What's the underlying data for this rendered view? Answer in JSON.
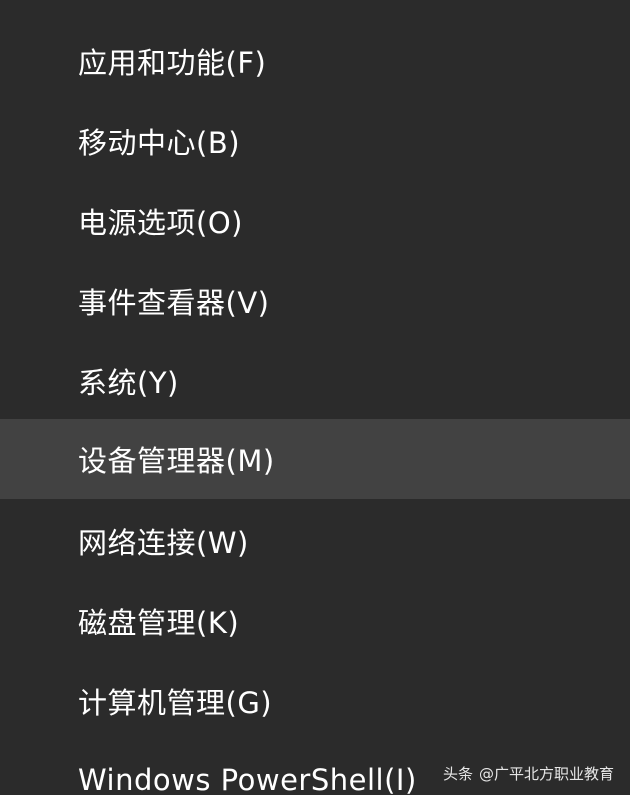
{
  "menu": {
    "items": [
      {
        "label": "应用和功能(F)"
      },
      {
        "label": "移动中心(B)"
      },
      {
        "label": "电源选项(O)"
      },
      {
        "label": "事件查看器(V)"
      },
      {
        "label": "系统(Y)"
      },
      {
        "label": "设备管理器(M)",
        "highlighted": true
      },
      {
        "label": "网络连接(W)"
      },
      {
        "label": "磁盘管理(K)"
      },
      {
        "label": "计算机管理(G)"
      },
      {
        "label": "Windows PowerShell(I)"
      }
    ]
  },
  "watermark": {
    "brand": "头条",
    "account": "@广平北方职业教育"
  },
  "colors": {
    "background": "#2b2b2b",
    "highlight": "#424242",
    "text": "#ffffff"
  }
}
